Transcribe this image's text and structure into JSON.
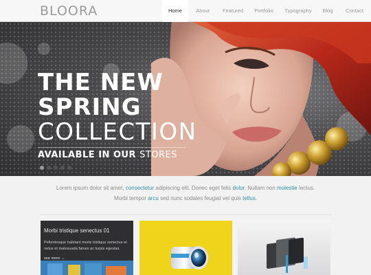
{
  "logo": "BLOORA",
  "nav": [
    "Home",
    "About",
    "Featured",
    "Portfolio",
    "Typography",
    "Blog",
    "Contact"
  ],
  "hero": {
    "line1": "THE NEW",
    "line2": "SPRING",
    "line3": "COLLECTION",
    "tagline_bold": "AVAILABLE IN OUR",
    "tagline_light": "STORES",
    "slide_count": 5,
    "active_slide": 1
  },
  "intro": {
    "p1_a": "Lorem ipsum dolor sit amet, ",
    "p1_b": "consectetur",
    "p1_c": " adipiscing elit. Donec eget felis ",
    "p1_d": "dolor",
    "p1_e": ". Nullam non ",
    "p1_f": "molestie",
    "p1_g": " lectus.",
    "p2_a": "Morbi tempor ",
    "p2_b": "arcu",
    "p2_c": " sed nunc sodales feugiat vel quis ",
    "p2_d": "tellus",
    "p2_e": "."
  },
  "thumbs": {
    "t1_title": "Morbi tristique senectus 01",
    "t1_body": "Pellentesque habitant morbi tristique senectus et netus et malesuada fames ac turpis egestas.",
    "t1_more": "see more →"
  },
  "colors": {
    "accent": "#2f8fa8",
    "hair": "#b8281a",
    "yellow": "#f0d41c"
  }
}
